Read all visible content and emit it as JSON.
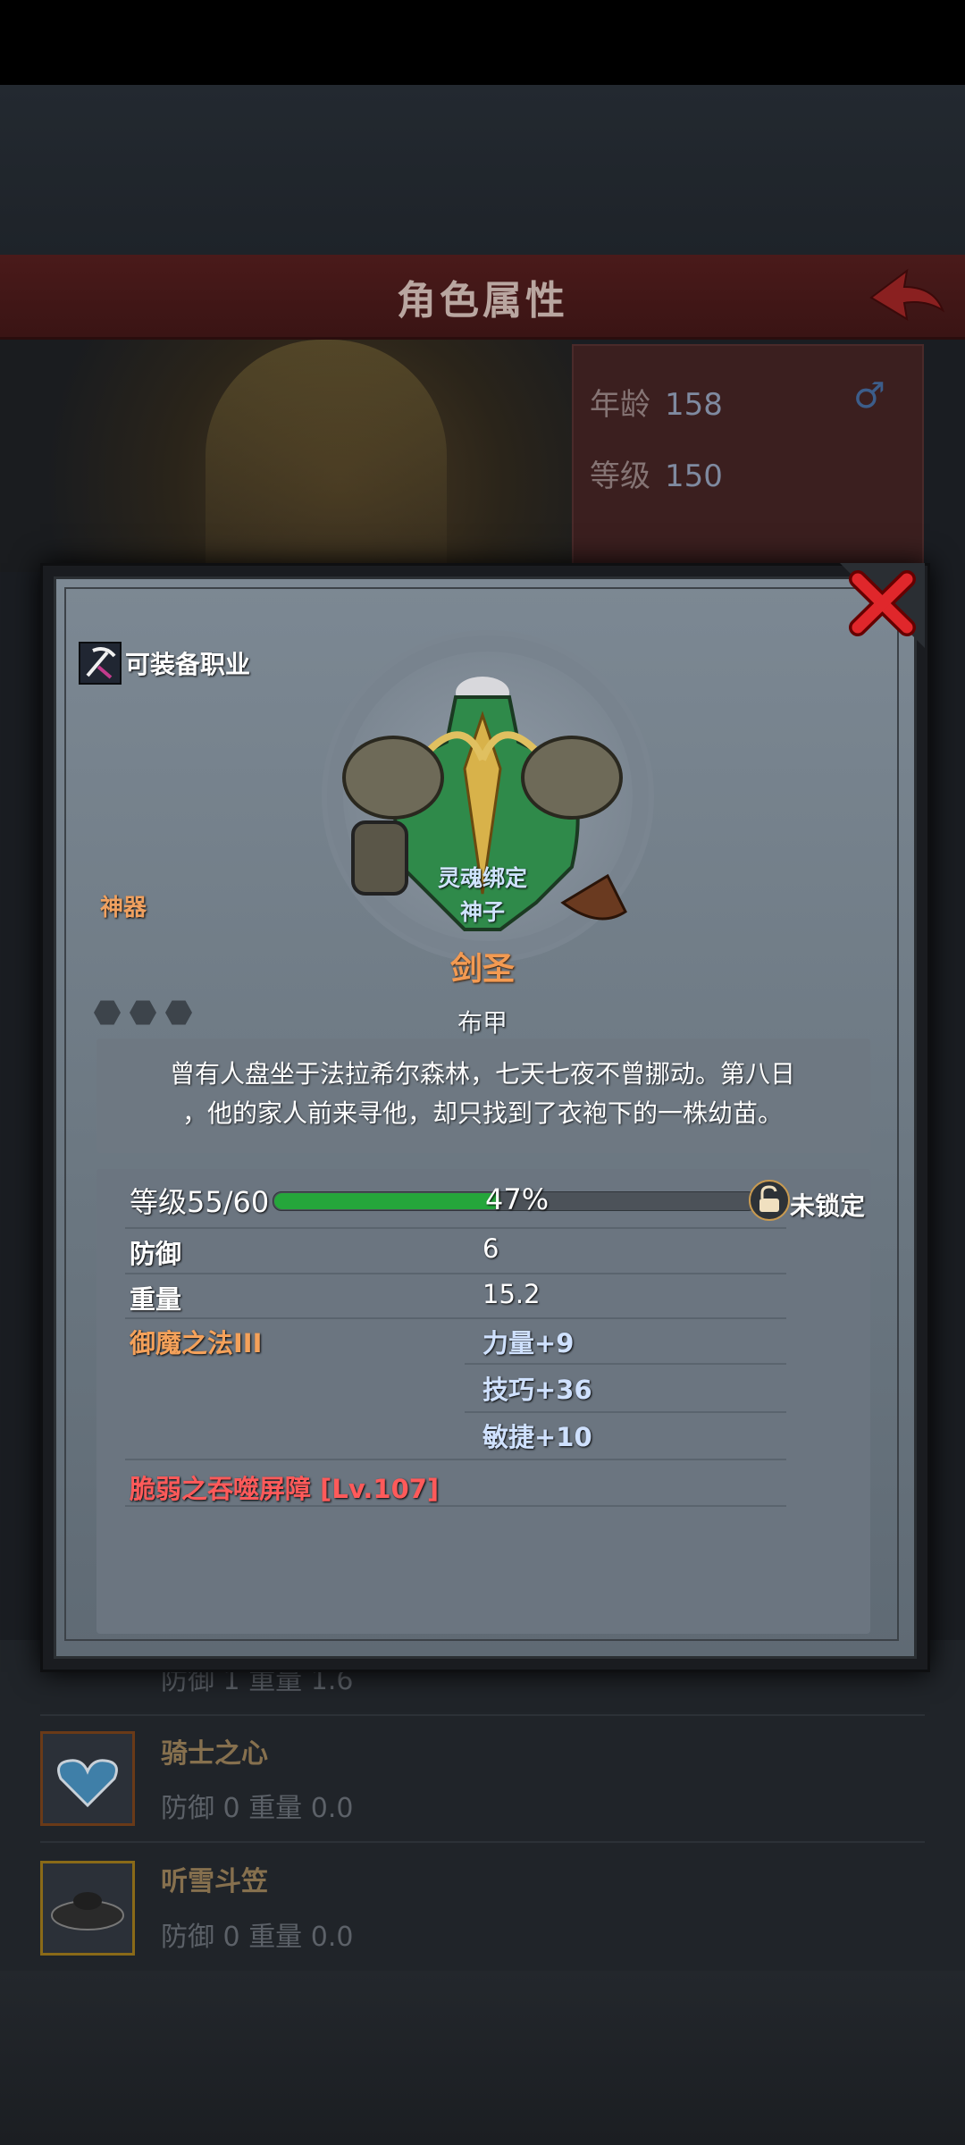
{
  "background": {
    "header_title": "角色属性",
    "stats": {
      "age_label": "年龄",
      "age_value": "158",
      "level_label": "等级",
      "level_value": "150"
    },
    "list_items": [
      {
        "name": "",
        "defense_label": "防御",
        "defense_value": "1",
        "weight_label": "重量",
        "weight_value": "1.6"
      },
      {
        "name": "骑士之心",
        "defense_label": "防御",
        "defense_value": "0",
        "weight_label": "重量",
        "weight_value": "0.0"
      },
      {
        "name": "听雪斗笠",
        "defense_label": "防御",
        "defense_value": "0",
        "weight_label": "重量",
        "weight_value": "0.0"
      }
    ]
  },
  "modal": {
    "equip_job_label": "可装备职业",
    "artifact_label": "神器",
    "soul_bound_label": "灵魂绑定",
    "godson_label": "神子",
    "item_name": "剑圣",
    "item_type": "布甲",
    "description_line1": "曾有人盘坐于法拉希尔森林，七天七夜不曾挪动。第八日",
    "description_line2": "，他的家人前来寻他，却只找到了衣袍下的一株幼苗。",
    "level": {
      "label": "等级",
      "value": "55/60",
      "progress_text": "47%",
      "progress": 0.47
    },
    "lock_label": "未锁定",
    "attributes": [
      {
        "name": "防御",
        "value": "6"
      },
      {
        "name": "重量",
        "value": "15.2"
      }
    ],
    "enchant_name": "御魔之法III",
    "bonuses": [
      "力量+9",
      "技巧+36",
      "敏捷+10"
    ],
    "skill": "脆弱之吞噬屏障 [Lv.107]"
  },
  "colors": {
    "artifact": "#f0a160",
    "item_name": "#f39a52",
    "skill": "#ff5a5a",
    "progress_fill": "#25a63b"
  },
  "icons": [
    "back-arrow-icon",
    "male-icon",
    "close-icon",
    "pickaxe-job-icon",
    "lock-icon",
    "hexagon-socket-icon"
  ]
}
